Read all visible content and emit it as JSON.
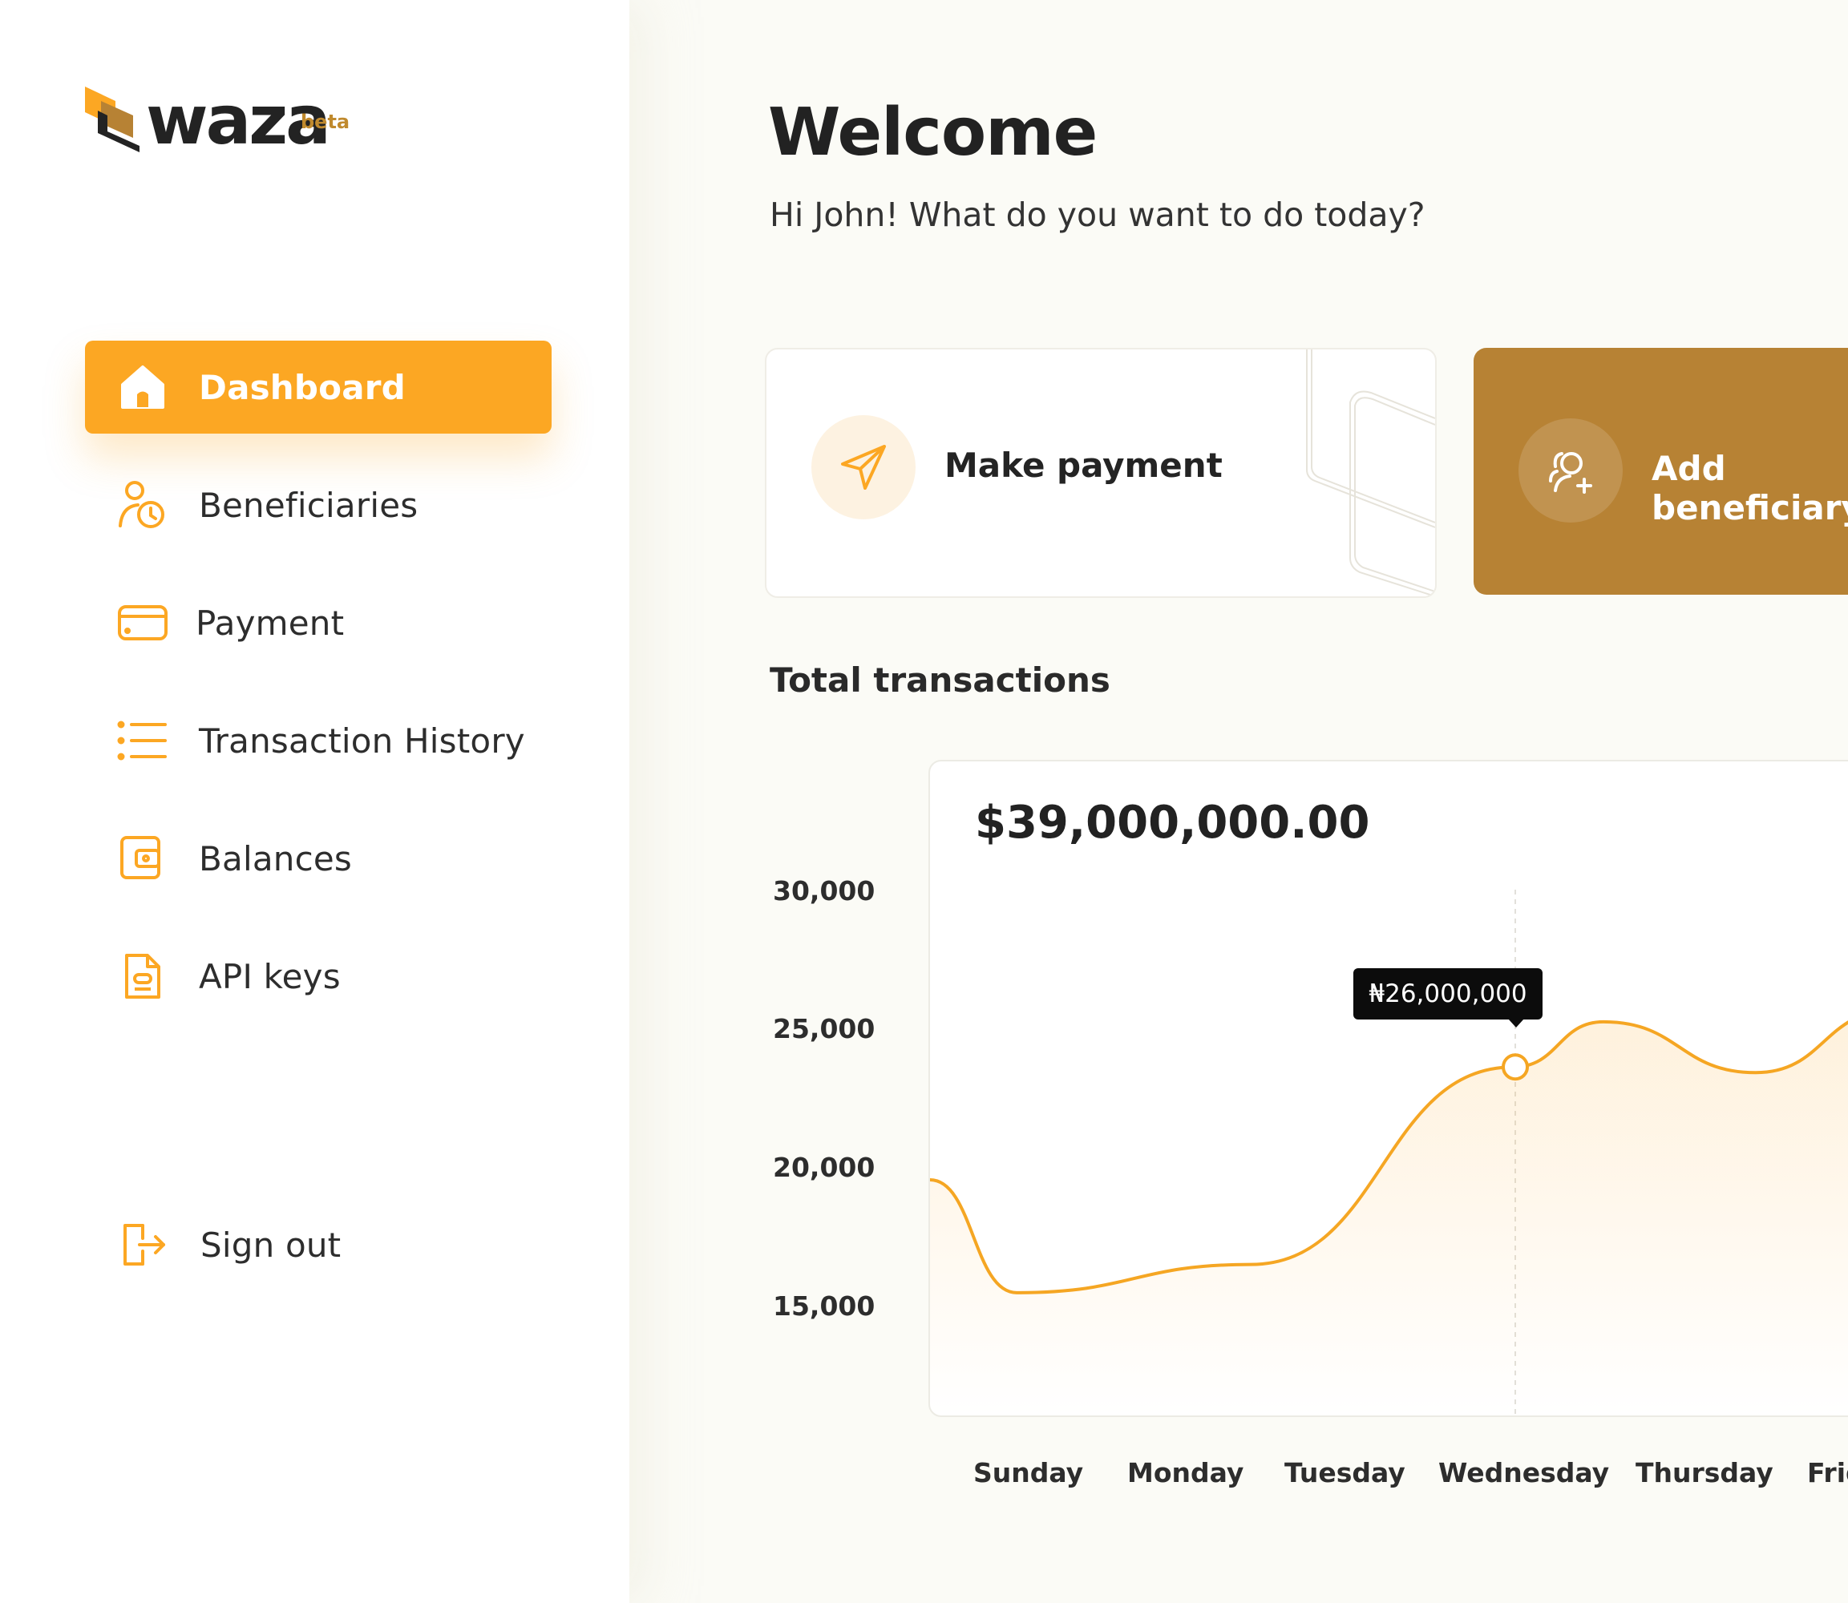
{
  "brand": {
    "name": "waza",
    "tag": "beta",
    "accent": "#fca723",
    "gold": "#b78234"
  },
  "sidebar": {
    "items": [
      {
        "label": "Dashboard",
        "icon": "home-icon",
        "active": true
      },
      {
        "label": "Beneficiaries",
        "icon": "beneficiaries-icon",
        "active": false
      },
      {
        "label": "Payment",
        "icon": "card-icon",
        "active": false
      },
      {
        "label": "Transaction History",
        "icon": "list-icon",
        "active": false
      },
      {
        "label": "Balances",
        "icon": "wallet-icon",
        "active": false
      },
      {
        "label": "API keys",
        "icon": "document-icon",
        "active": false
      }
    ],
    "signout": {
      "label": "Sign out",
      "icon": "sign-out-icon"
    }
  },
  "header": {
    "title": "Welcome",
    "subtitle": "Hi John! What do you want to do today?"
  },
  "actions": {
    "make_payment": {
      "label": "Make payment",
      "icon": "send-icon"
    },
    "add_beneficiary": {
      "label": "Add beneficiary",
      "icon": "add-user-icon"
    }
  },
  "transactions": {
    "section_title": "Total transactions",
    "total": "$39,000,000.00",
    "tooltip": "₦26,000,000"
  },
  "chart_data": {
    "type": "area",
    "categories": [
      "Sunday",
      "Monday",
      "Tuesday",
      "Wednesday",
      "Thursday",
      "Friday"
    ],
    "series": [
      {
        "values": [
          19800,
          15800,
          16800,
          23800,
          25400,
          23600,
          25800
        ]
      }
    ],
    "y_ticks": [
      "30,000",
      "25,000",
      "20,000",
      "15,000"
    ],
    "highlight": {
      "category": "Wednesday",
      "label": "₦26,000,000"
    },
    "ylim": [
      11000,
      33000
    ],
    "grid": false,
    "legend": "none"
  }
}
